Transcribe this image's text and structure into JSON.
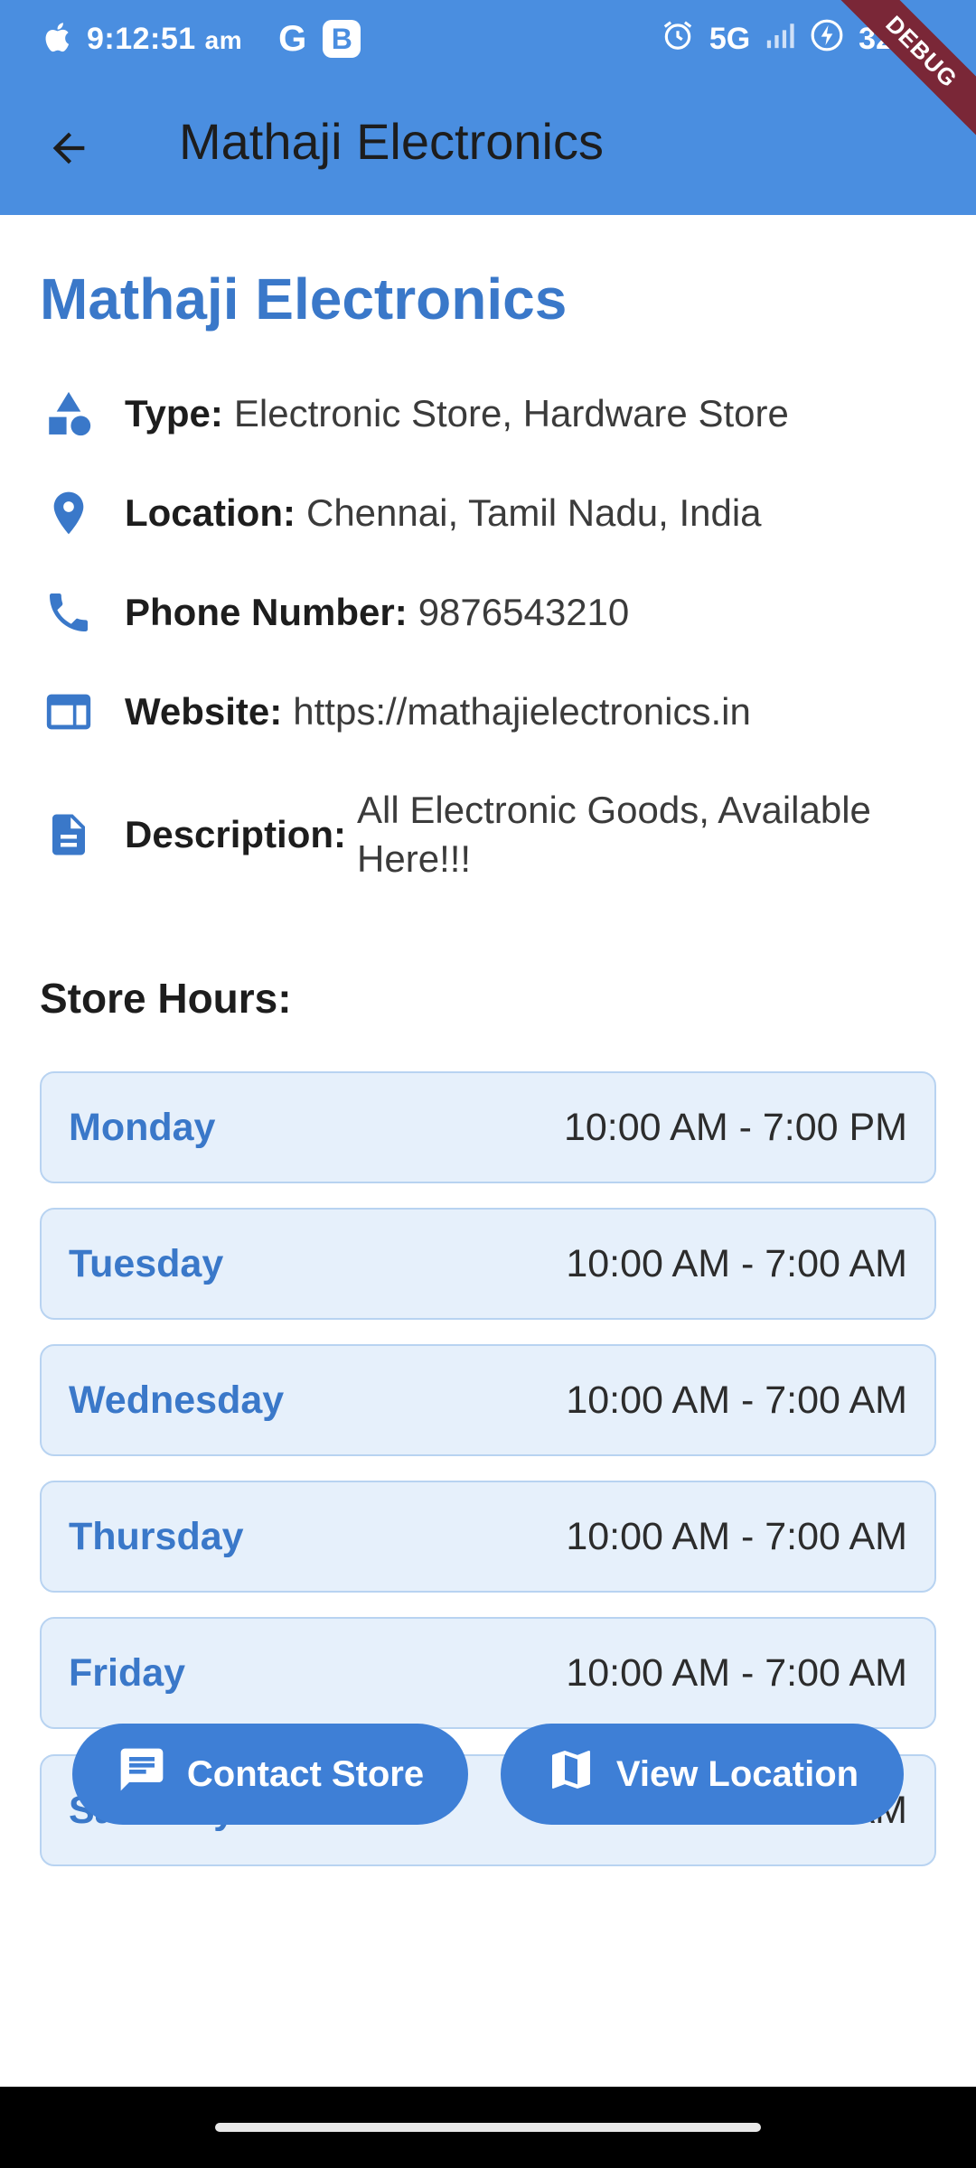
{
  "status_bar": {
    "time": "9:12:51",
    "ampm": "am",
    "g_icon_text": "G",
    "b_icon_text": "B",
    "network": "5G",
    "battery": "32",
    "debug_banner": "DEBUG"
  },
  "app_bar": {
    "title": "Mathaji Electronics",
    "back_icon": "arrow-back-icon"
  },
  "store": {
    "name": "Mathaji Electronics",
    "details": [
      {
        "icon": "category-shapes-icon",
        "label": "Type:",
        "value": "Electronic Store, Hardware Store"
      },
      {
        "icon": "location-pin-icon",
        "label": "Location:",
        "value": "Chennai, Tamil Nadu, India"
      },
      {
        "icon": "phone-icon",
        "label": "Phone Number:",
        "value": "9876543210"
      },
      {
        "icon": "web-icon",
        "label": "Website:",
        "value": "https://mathajielectronics.in"
      },
      {
        "icon": "description-icon",
        "label": "Description:",
        "value": "All Electronic Goods, Available Here!!!"
      }
    ]
  },
  "hours": {
    "title": "Store Hours:",
    "days": [
      {
        "day": "Monday",
        "time": "10:00 AM - 7:00 PM"
      },
      {
        "day": "Tuesday",
        "time": "10:00 AM - 7:00 AM"
      },
      {
        "day": "Wednesday",
        "time": "10:00 AM - 7:00 AM"
      },
      {
        "day": "Thursday",
        "time": "10:00 AM - 7:00 AM"
      },
      {
        "day": "Friday",
        "time": "10:00 AM - 7:00 AM"
      },
      {
        "day": "Saturday",
        "time": "10:00 AM - 7:00 AM"
      }
    ]
  },
  "actions": {
    "contact_label": "Contact Store",
    "contact_icon": "chat-icon",
    "location_label": "View Location",
    "location_icon": "map-icon"
  },
  "colors": {
    "primary": "#4a8ee0",
    "accent_text": "#3a78c9",
    "card_bg": "#e6f0fb",
    "button": "#3e7fd6"
  }
}
